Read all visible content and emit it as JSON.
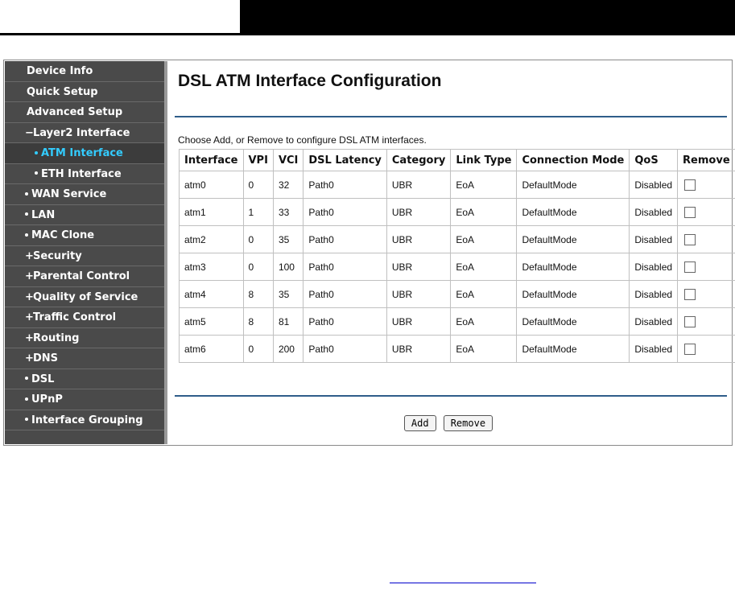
{
  "sidebar": {
    "items": [
      {
        "label": "Device Info",
        "level": 0,
        "icon": "",
        "active": false
      },
      {
        "label": "Quick Setup",
        "level": 0,
        "icon": "",
        "active": false
      },
      {
        "label": "Advanced Setup",
        "level": 0,
        "icon": "",
        "active": false
      },
      {
        "label": "Layer2 Interface",
        "level": 1,
        "icon": "minus",
        "active": false
      },
      {
        "label": "ATM Interface",
        "level": 2,
        "icon": "dot",
        "active": true
      },
      {
        "label": "ETH Interface",
        "level": 2,
        "icon": "dot",
        "active": false
      },
      {
        "label": "WAN Service",
        "level": 1,
        "icon": "dot",
        "active": false
      },
      {
        "label": "LAN",
        "level": 1,
        "icon": "dot",
        "active": false
      },
      {
        "label": "MAC Clone",
        "level": 1,
        "icon": "dot",
        "active": false
      },
      {
        "label": "Security",
        "level": 1,
        "icon": "plus",
        "active": false
      },
      {
        "label": "Parental Control",
        "level": 1,
        "icon": "plus",
        "active": false
      },
      {
        "label": "Quality of Service",
        "level": 1,
        "icon": "plus",
        "active": false
      },
      {
        "label": "Traffic Control",
        "level": 1,
        "icon": "plus",
        "active": false
      },
      {
        "label": "Routing",
        "level": 1,
        "icon": "plus",
        "active": false
      },
      {
        "label": "DNS",
        "level": 1,
        "icon": "plus",
        "active": false
      },
      {
        "label": "DSL",
        "level": 1,
        "icon": "dot",
        "active": false
      },
      {
        "label": "UPnP",
        "level": 1,
        "icon": "dot",
        "active": false
      },
      {
        "label": "Interface Grouping",
        "level": 1,
        "icon": "dot",
        "active": false
      }
    ]
  },
  "page": {
    "title": "DSL ATM Interface Configuration",
    "instructions": "Choose Add, or Remove to configure DSL ATM interfaces."
  },
  "table": {
    "headers": [
      "Interface",
      "VPI",
      "VCI",
      "DSL Latency",
      "Category",
      "Link Type",
      "Connection Mode",
      "QoS",
      "Remove"
    ],
    "rows": [
      [
        "atm0",
        "0",
        "32",
        "Path0",
        "UBR",
        "EoA",
        "DefaultMode",
        "Disabled"
      ],
      [
        "atm1",
        "1",
        "33",
        "Path0",
        "UBR",
        "EoA",
        "DefaultMode",
        "Disabled"
      ],
      [
        "atm2",
        "0",
        "35",
        "Path0",
        "UBR",
        "EoA",
        "DefaultMode",
        "Disabled"
      ],
      [
        "atm3",
        "0",
        "100",
        "Path0",
        "UBR",
        "EoA",
        "DefaultMode",
        "Disabled"
      ],
      [
        "atm4",
        "8",
        "35",
        "Path0",
        "UBR",
        "EoA",
        "DefaultMode",
        "Disabled"
      ],
      [
        "atm5",
        "8",
        "81",
        "Path0",
        "UBR",
        "EoA",
        "DefaultMode",
        "Disabled"
      ],
      [
        "atm6",
        "0",
        "200",
        "Path0",
        "UBR",
        "EoA",
        "DefaultMode",
        "Disabled"
      ]
    ],
    "remove_checked": [
      false,
      false,
      false,
      false,
      false,
      false,
      false
    ]
  },
  "buttons": {
    "add_label": "Add",
    "remove_label": "Remove"
  },
  "colors": {
    "sidebar_bg": "#4a4a4a",
    "active_item": "#33ccff",
    "rule": "#2f5d8a"
  }
}
